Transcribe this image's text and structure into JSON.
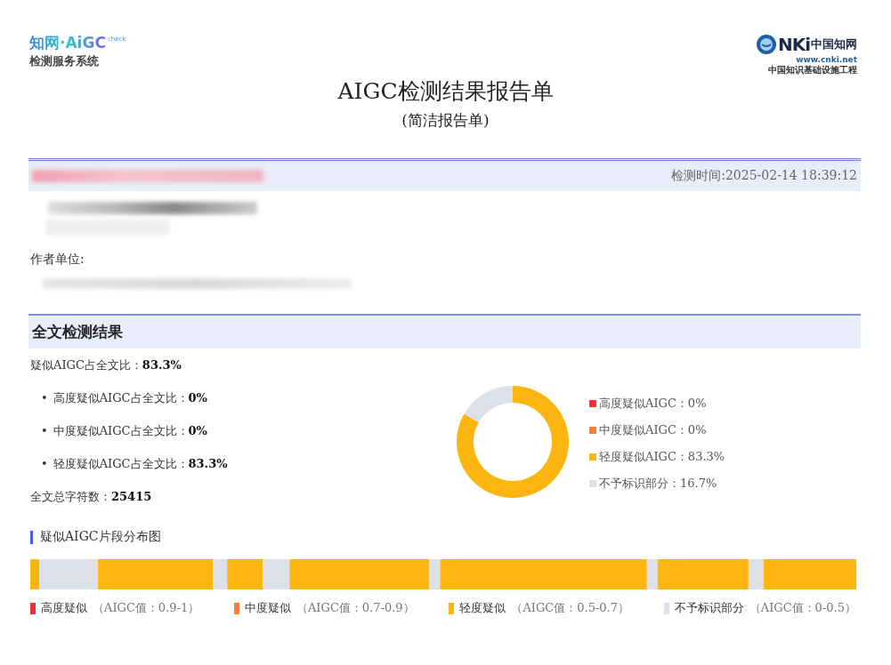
{
  "logo_left": {
    "brand": "知网·AiGC",
    "badge": "check",
    "subtitle": "检测服务系统"
  },
  "logo_right": {
    "brand": "NKi",
    "cn_name": "中国知网",
    "url": "www.cnki.net",
    "tagline": "中国知识基础设施工程"
  },
  "title": "AIGC检测结果报告单",
  "subtitle": "(简洁报告单)",
  "info": {
    "detect_time": "检测时间:2025-02-14 18:39:12",
    "author_unit_label": "作者单位:"
  },
  "result_section": {
    "heading": "全文检测结果",
    "summary": "疑似AIGC占全文比：**83.3%**",
    "items": [
      "高度疑似AIGC占全文比：**0%**",
      "中度疑似AIGC占全文比：**0%**",
      "轻度疑似AIGC占全文比：**83.3%**"
    ],
    "bullet": "•",
    "word_count": "全文总字符数：**25415**",
    "chart_data": {
      "type": "donut",
      "categories": [
        "高度疑似AIGC：0%",
        "中度疑似AIGC：0%",
        "轻度疑似AIGC：83.3%",
        "不予标识部分：16.7%"
      ],
      "values": [
        0,
        0,
        83.3,
        16.7
      ],
      "colors": [
        "#e8303a",
        "#f5803e",
        "#fdb60f",
        "#dde1e7"
      ]
    }
  },
  "distribution": {
    "heading": "疑似AIGC片段分布图",
    "legend": [
      {
        "label": "高度疑似",
        "range": "（AIGC值：0.9-1）",
        "color": "#e8303a"
      },
      {
        "label": "中度疑似",
        "range": "（AIGC值：0.7-0.9）",
        "color": "#f5803e"
      },
      {
        "label": "轻度疑似",
        "range": "（AIGC值：0.5-0.7）",
        "color": "#fdb60f"
      },
      {
        "label": "不予标识部分",
        "range": "（AIGC值：0-0.5）",
        "color": "#dde1e7"
      }
    ]
  }
}
